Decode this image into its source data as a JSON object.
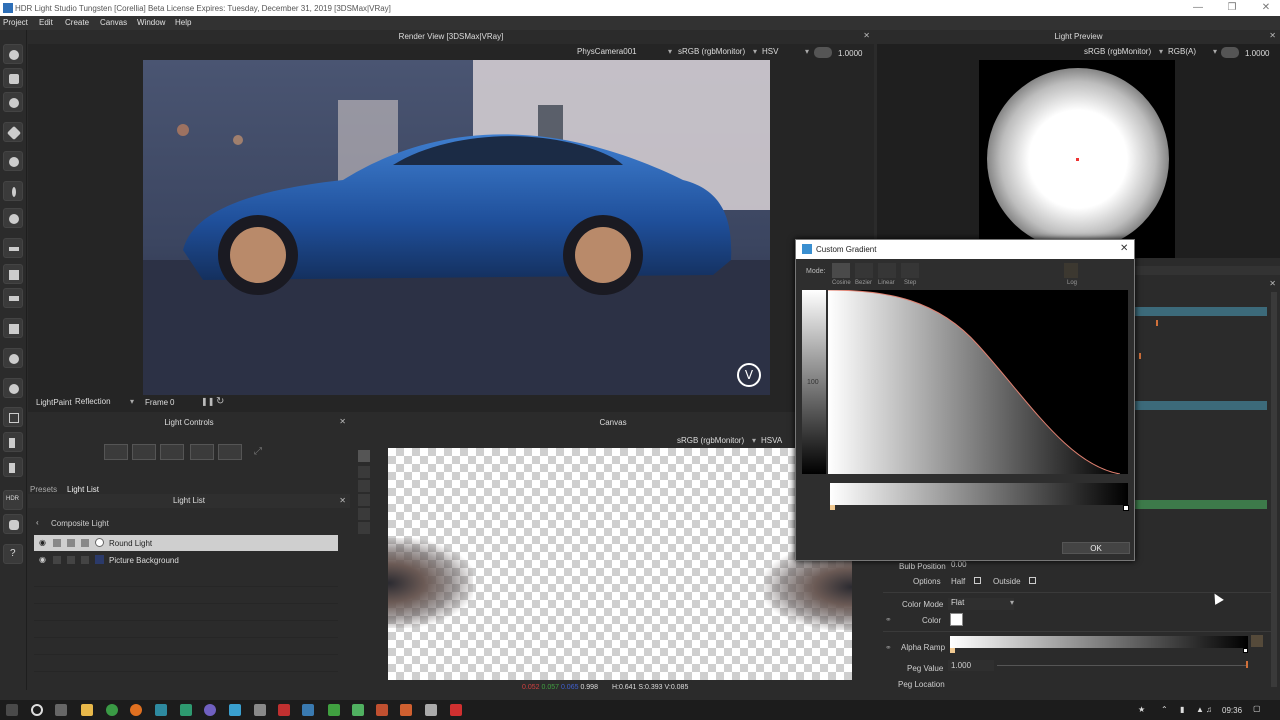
{
  "window": {
    "title": "HDR Light Studio Tungsten [Corellia] Beta License Expires: Tuesday, December 31, 2019 [3DSMax|VRay]"
  },
  "menu": [
    "Project",
    "Edit",
    "Create",
    "Canvas",
    "Window",
    "Help"
  ],
  "render_view": {
    "title": "Render View [3DSMax|VRay]",
    "camera": "PhysCamera001",
    "colorspace": "sRGB (rgbMonitor)",
    "mode": "HSV",
    "exposure": "1.0000",
    "lightpaint_label": "LightPaint",
    "lightpaint_mode": "Reflection",
    "frame_label": "Frame",
    "frame_value": "0"
  },
  "light_preview": {
    "title": "Light Preview",
    "colorspace": "sRGB (rgbMonitor)",
    "mode": "RGB(A)",
    "exposure": "1.0000"
  },
  "light_controls": {
    "title": "Light Controls"
  },
  "light_list": {
    "tabs": [
      "Presets",
      "Light List"
    ],
    "title": "Light List",
    "group": "Composite Light",
    "items": [
      {
        "name": "Round Light",
        "selected": true
      },
      {
        "name": "Picture Background",
        "selected": false
      }
    ]
  },
  "canvas": {
    "title": "Canvas",
    "colorspace": "sRGB (rgbMonitor)",
    "mode": "HSVA",
    "readout_r": "0.052",
    "readout_g": "0.057",
    "readout_b": "0.065",
    "readout_a": "0.998",
    "readout_hsv": "H:0.641 S:0.393 V:0.085"
  },
  "dialog": {
    "title": "Custom Gradient",
    "mode_label": "Mode:",
    "modes": [
      "Cosine",
      "Bezier",
      "Linear",
      "Step"
    ],
    "log_label": "Log",
    "scale_value": "100",
    "ok_label": "OK"
  },
  "properties": {
    "bulb_position_label": "Bulb Position",
    "bulb_position_value": "0.00",
    "options_label": "Options",
    "half_label": "Half",
    "outside_label": "Outside",
    "color_mode_label": "Color Mode",
    "color_mode_value": "Flat",
    "color_label": "Color",
    "alpha_ramp_label": "Alpha Ramp",
    "peg_value_label": "Peg Value",
    "peg_value": "1.000",
    "peg_location_label": "Peg Location"
  },
  "taskbar": {
    "time": "09:36"
  },
  "colors": {
    "accent": "#3c6a7a",
    "green": "#3d7a4a",
    "selected": "#cfcfcf"
  }
}
